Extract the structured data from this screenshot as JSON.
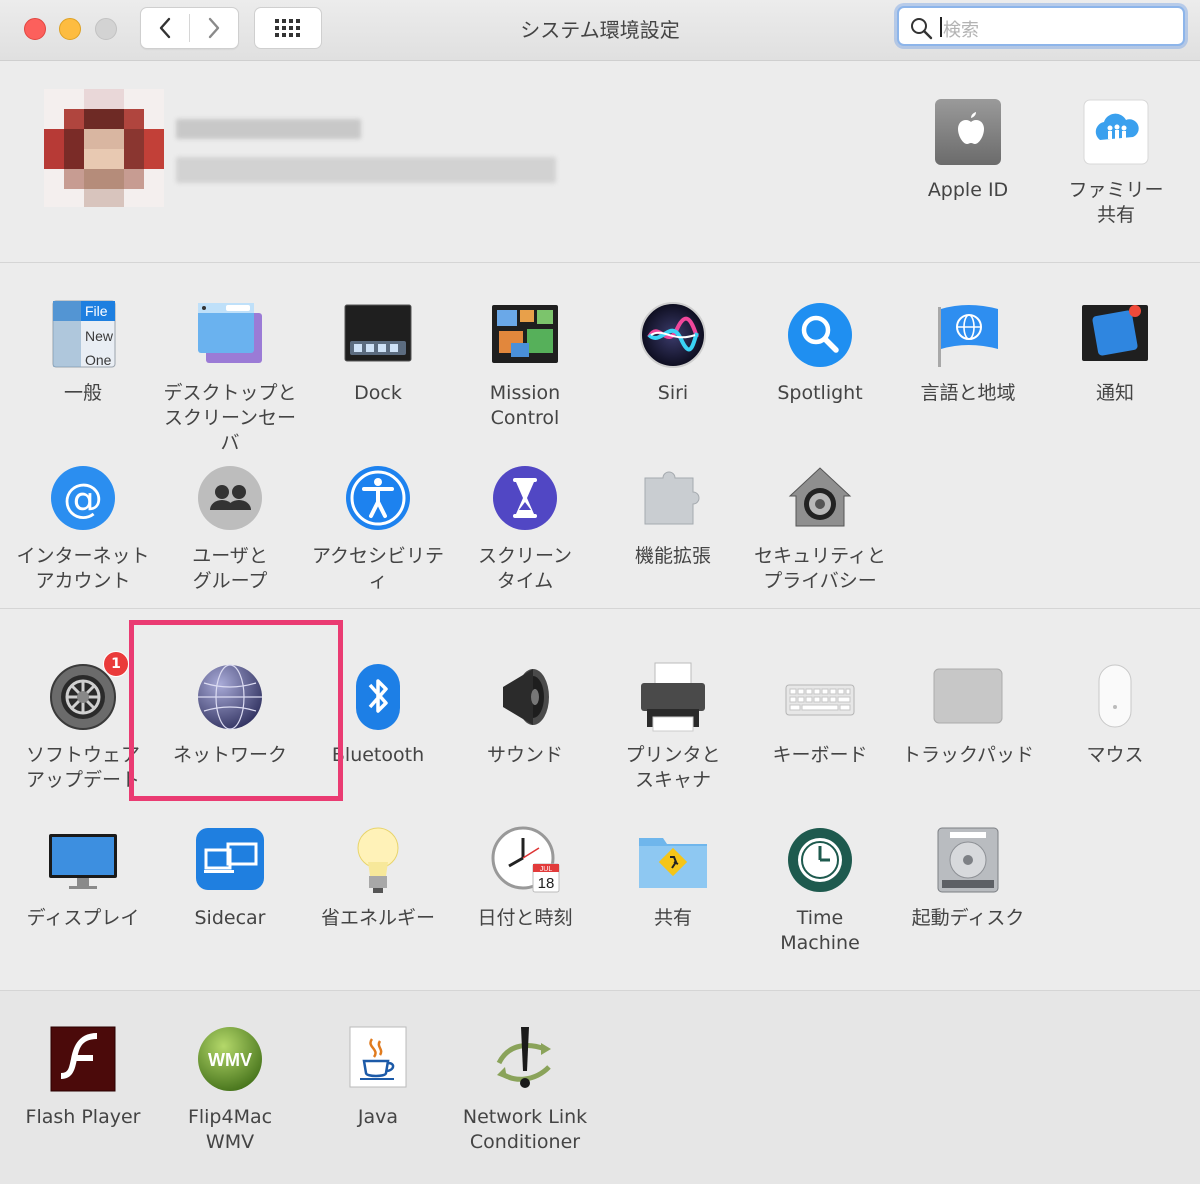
{
  "window": {
    "title": "システム環境設定",
    "search_placeholder": "検索"
  },
  "apple_section": {
    "items": [
      {
        "id": "apple-id",
        "label": "Apple ID",
        "icon": "apple-logo-icon"
      },
      {
        "id": "family-sharing",
        "label": "ファミリー\n共有",
        "icon": "family-icon"
      }
    ]
  },
  "panes": [
    {
      "id": "general",
      "label": "一般",
      "icon": "general-icon"
    },
    {
      "id": "desktop",
      "label": "デスクトップと\nスクリーンセーバ",
      "icon": "desktop-icon"
    },
    {
      "id": "dock",
      "label": "Dock",
      "icon": "dock-icon"
    },
    {
      "id": "mission-control",
      "label": "Mission\nControl",
      "icon": "mission-control-icon"
    },
    {
      "id": "siri",
      "label": "Siri",
      "icon": "siri-icon"
    },
    {
      "id": "spotlight",
      "label": "Spotlight",
      "icon": "spotlight-icon"
    },
    {
      "id": "language",
      "label": "言語と地域",
      "icon": "flag-globe-icon"
    },
    {
      "id": "notifications",
      "label": "通知",
      "icon": "notifications-icon"
    },
    {
      "id": "internet-accounts",
      "label": "インターネット\nアカウント",
      "icon": "at-sign-icon"
    },
    {
      "id": "users",
      "label": "ユーザと\nグループ",
      "icon": "users-icon"
    },
    {
      "id": "accessibility",
      "label": "アクセシビリティ",
      "icon": "accessibility-icon"
    },
    {
      "id": "screen-time",
      "label": "スクリーン\nタイム",
      "icon": "hourglass-icon"
    },
    {
      "id": "extensions",
      "label": "機能拡張",
      "icon": "puzzle-icon"
    },
    {
      "id": "security",
      "label": "セキュリティと\nプライバシー",
      "icon": "house-lock-icon"
    },
    {
      "id": "software-update",
      "label": "ソフトウェア\nアップデート",
      "icon": "gear-icon",
      "badge": "1"
    },
    {
      "id": "network",
      "label": "ネットワーク",
      "icon": "network-globe-icon"
    },
    {
      "id": "bluetooth",
      "label": "Bluetooth",
      "icon": "bluetooth-icon"
    },
    {
      "id": "sound",
      "label": "サウンド",
      "icon": "speaker-icon"
    },
    {
      "id": "printers",
      "label": "プリンタと\nスキャナ",
      "icon": "printer-icon"
    },
    {
      "id": "keyboard",
      "label": "キーボード",
      "icon": "keyboard-icon"
    },
    {
      "id": "trackpad",
      "label": "トラックパッド",
      "icon": "trackpad-icon"
    },
    {
      "id": "mouse",
      "label": "マウス",
      "icon": "mouse-icon"
    },
    {
      "id": "displays",
      "label": "ディスプレイ",
      "icon": "display-icon"
    },
    {
      "id": "sidecar",
      "label": "Sidecar",
      "icon": "sidecar-icon"
    },
    {
      "id": "energy",
      "label": "省エネルギー",
      "icon": "lightbulb-icon"
    },
    {
      "id": "date-time",
      "label": "日付と時刻",
      "icon": "clock-icon"
    },
    {
      "id": "sharing",
      "label": "共有",
      "icon": "sharing-folder-icon"
    },
    {
      "id": "time-machine",
      "label": "Time\nMachine",
      "icon": "time-machine-icon"
    },
    {
      "id": "startup-disk",
      "label": "起動ディスク",
      "icon": "hard-drive-icon"
    },
    {
      "id": "flash-player",
      "label": "Flash Player",
      "icon": "flash-icon"
    },
    {
      "id": "flip4mac",
      "label": "Flip4Mac\nWMV",
      "icon": "wmv-icon"
    },
    {
      "id": "java",
      "label": "Java",
      "icon": "java-icon"
    },
    {
      "id": "nlc",
      "label": "Network Link\nConditioner",
      "icon": "network-link-icon"
    }
  ],
  "icon_text": {
    "general_file": "File",
    "general_new": "New",
    "general_open": "One",
    "clock_month": "JUL",
    "clock_day": "18",
    "wmv": "WMV"
  },
  "colors": {
    "highlight": "#ea3b72",
    "badge": "#ea3b3b",
    "accent": "#1a82fb"
  }
}
